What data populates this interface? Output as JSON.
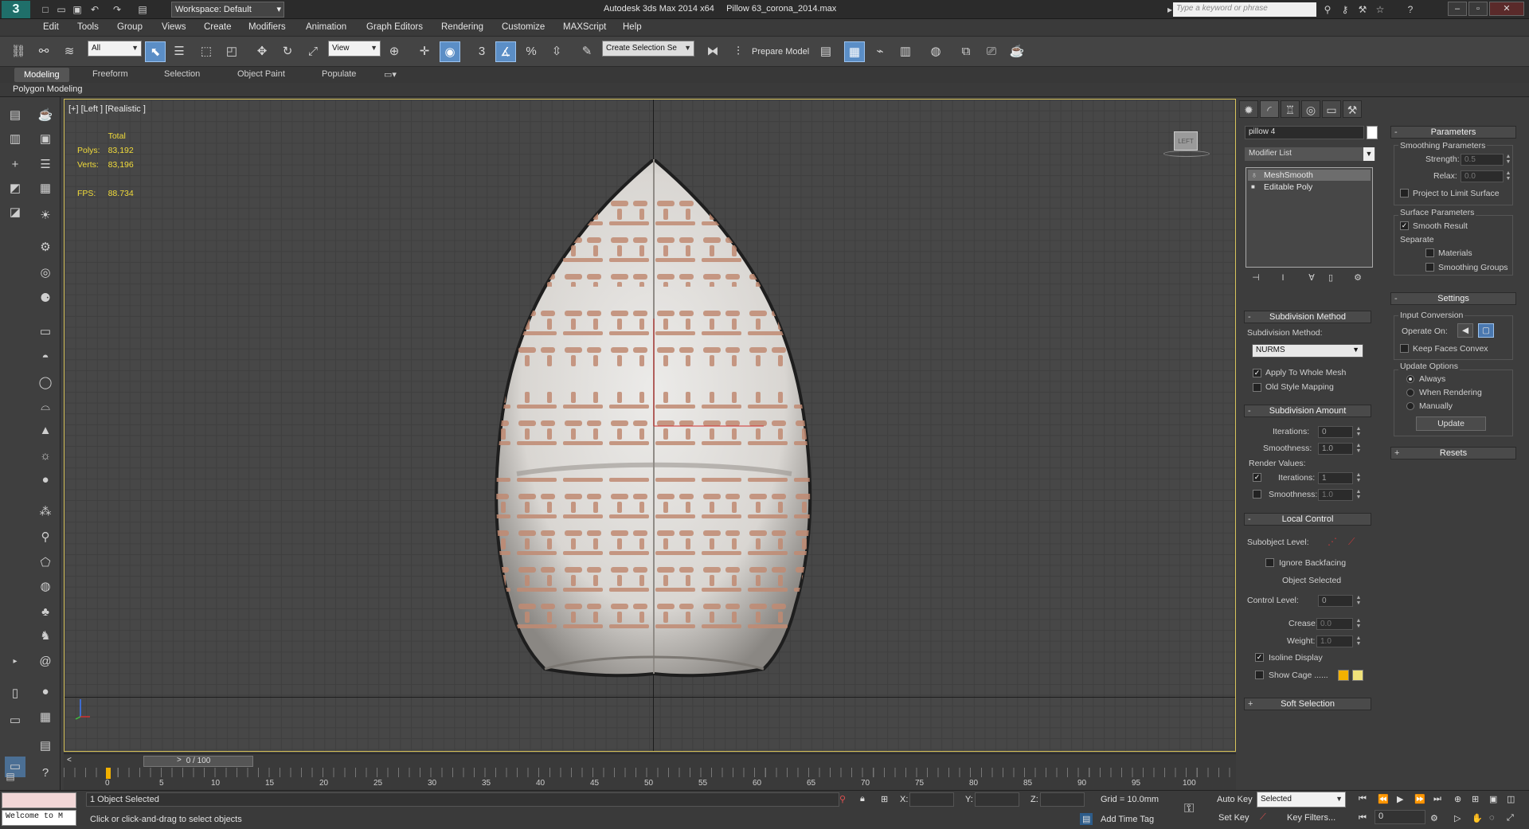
{
  "app": {
    "title": "Autodesk 3ds Max  2014 x64",
    "file": "Pillow 63_corona_2014.max",
    "workspace": "Workspace: Default",
    "search_placeholder": "Type a keyword or phrase",
    "logo": "3"
  },
  "menu": [
    "Edit",
    "Tools",
    "Group",
    "Views",
    "Create",
    "Modifiers",
    "Animation",
    "Graph Editors",
    "Rendering",
    "Customize",
    "MAXScript",
    "Help"
  ],
  "toolbar": {
    "filter": "All",
    "refcoord": "View",
    "selection_set": "Create Selection Se",
    "prepare_model": "Prepare Model",
    "snap_labels": [
      "3",
      "%"
    ]
  },
  "ribbon": {
    "tabs": [
      "Modeling",
      "Freeform",
      "Selection",
      "Object Paint",
      "Populate"
    ],
    "panel": "Polygon Modeling"
  },
  "viewport": {
    "label": "[+] [Left ] [Realistic ]",
    "stats_header": "Total",
    "stats": [
      {
        "label": "Polys:",
        "value": "83,192"
      },
      {
        "label": "Verts:",
        "value": "83,196"
      }
    ],
    "fps_label": "FPS:",
    "fps_value": "88.734",
    "viewcube": "LEFT"
  },
  "command_panel": {
    "object_name": "pillow 4",
    "modifier_list": "Modifier List",
    "stack": [
      {
        "name": "MeshSmooth",
        "selected": true
      },
      {
        "name": "Editable Poly",
        "selected": false
      }
    ],
    "subdivision_method": {
      "title": "Subdivision Method",
      "label": "Subdivision Method:",
      "value": "NURMS",
      "apply_whole_mesh": {
        "label": "Apply To Whole Mesh",
        "checked": true
      },
      "old_style_mapping": {
        "label": "Old Style Mapping",
        "checked": false
      }
    },
    "subdivision_amount": {
      "title": "Subdivision Amount",
      "iterations_label": "Iterations:",
      "iterations": "0",
      "smoothness_label": "Smoothness:",
      "smoothness": "1.0",
      "render_values": "Render Values:",
      "render_iterations": "1",
      "render_iterations_checked": true,
      "render_smoothness": "1.0",
      "render_smoothness_checked": false
    },
    "local_control": {
      "title": "Local Control",
      "subobject_level": "Subobject Level:",
      "ignore_backfacing": "Ignore Backfacing",
      "object_selected": "Object Selected",
      "control_level_label": "Control Level:",
      "control_level": "0",
      "crease_label": "Crease:",
      "crease": "0.0",
      "weight_label": "Weight:",
      "weight": "1.0",
      "isoline_display": "Isoline Display",
      "isoline_checked": true,
      "show_cage": "Show Cage ......",
      "cage_colors": [
        "#f2b100",
        "#f0e27a"
      ]
    },
    "soft_selection": "Soft Selection",
    "parameters": {
      "title": "Parameters",
      "smoothing_parameters": "Smoothing Parameters",
      "strength_label": "Strength:",
      "strength": "0.5",
      "relax_label": "Relax:",
      "relax": "0.0",
      "project_limit": "Project to Limit Surface",
      "surface_parameters": "Surface Parameters",
      "smooth_result": "Smooth Result",
      "separate": "Separate",
      "materials": "Materials",
      "smoothing_groups": "Smoothing Groups"
    },
    "settings": {
      "title": "Settings",
      "input_conversion": "Input Conversion",
      "operate_on": "Operate On:",
      "keep_faces_convex": "Keep Faces Convex",
      "update_options": "Update Options",
      "always": "Always",
      "when_rendering": "When Rendering",
      "manually": "Manually",
      "update_button": "Update"
    },
    "resets": "Resets"
  },
  "timeline": {
    "slider": "0 / 100",
    "ticks": [
      "0",
      "5",
      "10",
      "15",
      "20",
      "25",
      "30",
      "35",
      "40",
      "45",
      "50",
      "55",
      "60",
      "65",
      "70",
      "75",
      "80",
      "85",
      "90",
      "95",
      "100"
    ]
  },
  "status": {
    "maxscript_line": "Welcome to M",
    "selection": "1 Object Selected",
    "prompt": "Click or click-and-drag to select objects",
    "x_label": "X:",
    "y_label": "Y:",
    "z_label": "Z:",
    "grid": "Grid = 10.0mm",
    "add_time_tag": "Add Time Tag",
    "auto_key": "Auto Key",
    "set_key": "Set Key",
    "key_mode": "Selected",
    "key_filters": "Key Filters...",
    "frame": "0"
  },
  "colors": {
    "viewport_border": "#d7c35a",
    "stats": "#f2dc3a",
    "active_tool": "#5b8ec6",
    "pattern": "#c08a72"
  }
}
